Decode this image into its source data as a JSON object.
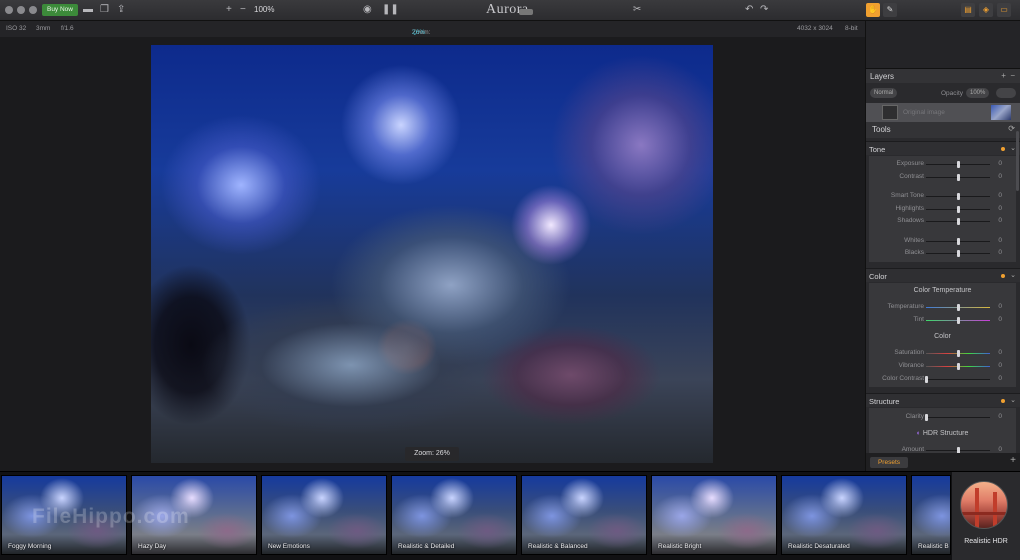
{
  "titlebar": {
    "buy_label": "Buy Now",
    "zoom_label": "100%",
    "app_name": "Aurora"
  },
  "infobar": {
    "iso": "ISO 32",
    "focal": "3mm",
    "aperture": "f/1.6",
    "zoom_label": "Zoom:",
    "zoom_value": "26%",
    "dimensions": "4032 x 3024",
    "bitdepth": "8-bit"
  },
  "canvas": {
    "zoom_overlay": "Zoom: 26%"
  },
  "panel": {
    "layers_title": "Layers",
    "blend_mode": "Normal",
    "opacity_label": "Opacity",
    "opacity_value": "100%",
    "layer_name": "Original image",
    "tools_title": "Tools",
    "tone": {
      "title": "Tone",
      "sliders": [
        {
          "name": "Exposure",
          "value": "0"
        },
        {
          "name": "Contrast",
          "value": "0"
        },
        {
          "name": "Smart Tone",
          "value": "0"
        },
        {
          "name": "Highlights",
          "value": "0"
        },
        {
          "name": "Shadows",
          "value": "0"
        },
        {
          "name": "Whites",
          "value": "0"
        },
        {
          "name": "Blacks",
          "value": "0"
        }
      ]
    },
    "color": {
      "title": "Color",
      "temp_head": "Color Temperature",
      "color_head": "Color",
      "sliders": [
        {
          "name": "Temperature",
          "value": "0"
        },
        {
          "name": "Tint",
          "value": "0"
        },
        {
          "name": "Saturation",
          "value": "0"
        },
        {
          "name": "Vibrance",
          "value": "0"
        },
        {
          "name": "Color Contrast",
          "value": "0"
        }
      ]
    },
    "structure": {
      "title": "Structure",
      "sliders": [
        {
          "name": "Clarity",
          "value": "0"
        }
      ],
      "hdr_structure": "HDR Structure",
      "amount_label": "Amount",
      "amount_value": "0"
    },
    "presets_label": "Presets"
  },
  "presets": [
    {
      "label": "Foggy Morning"
    },
    {
      "label": "Hazy Day"
    },
    {
      "label": "New Emotions"
    },
    {
      "label": "Realistic & Detailed"
    },
    {
      "label": "Realistic & Balanced"
    },
    {
      "label": "Realistic Bright"
    },
    {
      "label": "Realistic Desaturated"
    },
    {
      "label": "Realistic B"
    }
  ],
  "category": {
    "label": "Realistic HDR"
  },
  "watermark": "FileHippo.com"
}
